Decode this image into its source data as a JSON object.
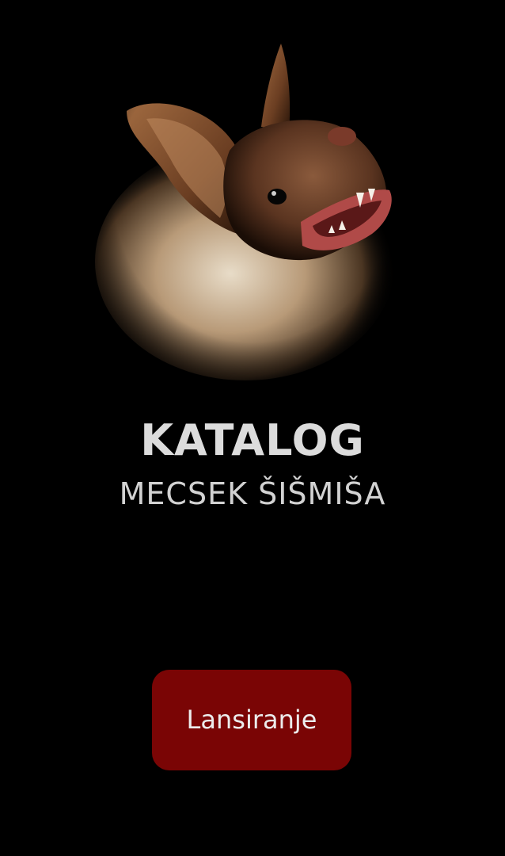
{
  "splash": {
    "title": "KATALOG",
    "subtitle": "MECSEK ŠIŠMIŠA",
    "launch_label": "Lansiranje"
  },
  "colors": {
    "background": "#000000",
    "button": "#7a0505",
    "text": "#dcdcdc"
  },
  "hero": {
    "icon": "bat-photo"
  }
}
